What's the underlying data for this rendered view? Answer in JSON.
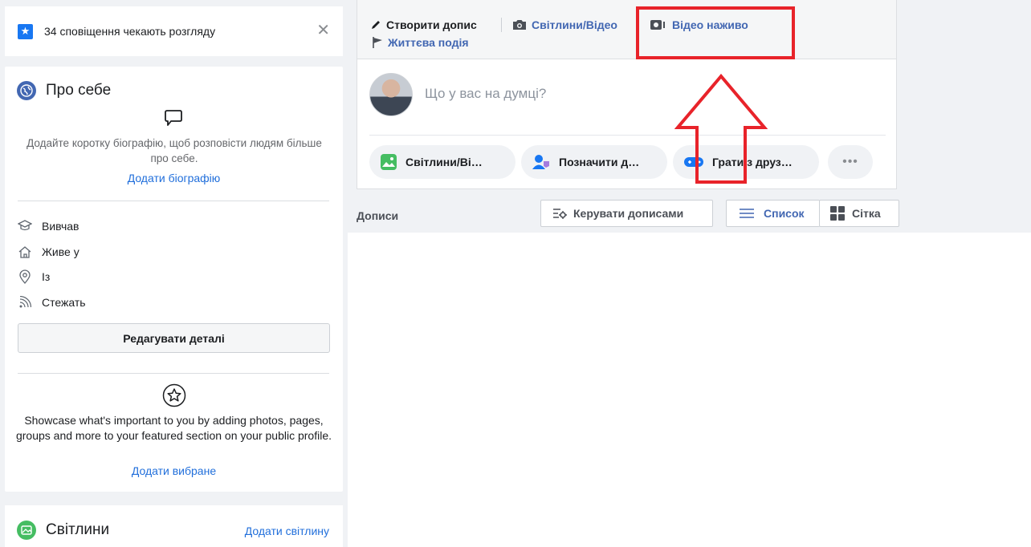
{
  "notification": {
    "count_text": "34 сповіщення чекають розгляду",
    "close": "✕"
  },
  "about": {
    "title": "Про себе",
    "bio_prompt": "Додайте коротку біографію, щоб розповісти людям більше про себе.",
    "bio_link": "Додати біографію",
    "details": [
      {
        "label": "Вивчав",
        "icon": "graduation-icon"
      },
      {
        "label": "Живе у",
        "icon": "home-icon"
      },
      {
        "label": "Із",
        "icon": "location-pin-icon"
      },
      {
        "label": "Стежать",
        "icon": "rss-icon"
      }
    ],
    "edit_button": "Редагувати деталі",
    "featured_text": "Showcase what's important to you by adding photos, pages, groups and more to your featured section on your public profile.",
    "featured_link": "Додати вибране"
  },
  "photos": {
    "title": "Світлини",
    "add_link": "Додати світлину"
  },
  "composer": {
    "tabs": {
      "create_post": "Створити допис",
      "photo_video": "Світлини/Відео",
      "live_video": "Відео наживо",
      "life_event": "Життєва подія"
    },
    "placeholder": "Що у вас на думці?",
    "actions": {
      "photos": "Світлини/Ві…",
      "tag": "Позначити д…",
      "play": "Грати з друз…",
      "more": "•••"
    }
  },
  "posts": {
    "label": "Дописи",
    "manage": "Керувати дописами",
    "list": "Список",
    "grid": "Сітка"
  },
  "colors": {
    "accent": "#1877f2",
    "link": "#216fdb",
    "annotation": "#e8232a"
  }
}
